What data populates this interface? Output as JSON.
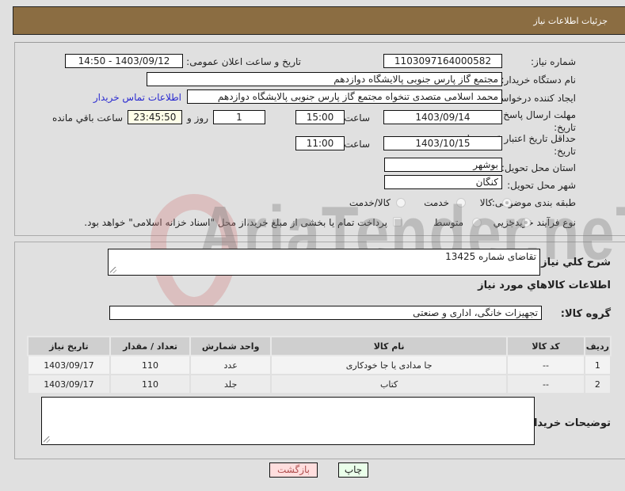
{
  "header": {
    "title": "جزئیات اطلاعات نیاز"
  },
  "form": {
    "need_number": {
      "label": "شماره نیاز:",
      "value": "1103097164000582"
    },
    "announce_datetime": {
      "label": "تاریخ و ساعت اعلان عمومی:",
      "value": "1403/09/12 - 14:50"
    },
    "buyer_org": {
      "label": "نام دستگاه خریدار:",
      "value": "مجتمع گاز پارس جنوبی  پالایشگاه دوازدهم"
    },
    "requester": {
      "label": "ایجاد کننده درخواست:",
      "value": "محمد اسلامی متصدی تنخواه مجتمع گاز پارس جنوبی  پالایشگاه دوازدهم",
      "contact_link": "اطلاعات تماس خریدار"
    },
    "reply_deadline": {
      "label": "مهلت ارسال پاسخ: تا تاریخ:",
      "date": "1403/09/14",
      "time_label": "ساعت",
      "time": "15:00",
      "days": "1",
      "days_label": "روز و",
      "remaining": "23:45:50",
      "remaining_label": "ساعت باقي مانده"
    },
    "price_validity": {
      "label": "حداقل تاریخ اعتبار قیمت: تا تاریخ:",
      "date": "1403/10/15",
      "time_label": "ساعت",
      "time": "11:00"
    },
    "province": {
      "label": "استان محل تحویل:",
      "value": "بوشهر"
    },
    "city": {
      "label": "شهر محل تحویل:",
      "value": "کنگان"
    },
    "category": {
      "label": "طبقه بندی موضوعی:",
      "options": [
        "کالا",
        "خدمت",
        "کالا/خدمت"
      ],
      "selected": "کالا"
    },
    "purchase_type": {
      "label": "نوع فرآیند خرید :",
      "options": [
        "جزیي",
        "متوسط"
      ],
      "selected": "جزیي",
      "payment_note": "پرداخت تمام یا بخشی از مبلغ خرید،از محل \"اسناد خزانه اسلامی\" خواهد بود."
    }
  },
  "details": {
    "description_label": "شرح كلي نياز:",
    "description": "تقاضای شماره 13425",
    "goods_info_title": "اطلاعات كالاهاي مورد نياز",
    "goods_group_label": "گروه کالا:",
    "goods_group": "تجهیزات خانگی، اداری و صنعتی",
    "table": {
      "headers": [
        "ردیف",
        "کد کالا",
        "نام کالا",
        "واحد شمارش",
        "تعداد / مقدار",
        "تاریخ نیاز"
      ],
      "rows": [
        [
          "1",
          "--",
          "جا مدادی یا جا خودکاری",
          "عدد",
          "110",
          "1403/09/17"
        ],
        [
          "2",
          "--",
          "کتاب",
          "جلد",
          "110",
          "1403/09/17"
        ]
      ]
    },
    "buyer_notes_label": "توضیحات خریدار:",
    "buyer_notes": ""
  },
  "buttons": {
    "print": "چاپ",
    "back": "بازگشت"
  },
  "watermark": "AriaTender.neT",
  "colors": {
    "header_bg": "#8b6d42",
    "link": "#2a2ad0",
    "print_bg": "#eaffea",
    "back_bg": "#ffdede"
  }
}
